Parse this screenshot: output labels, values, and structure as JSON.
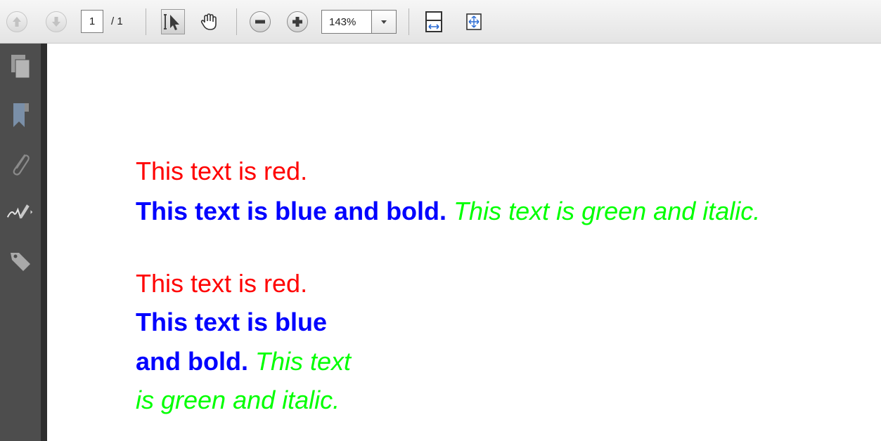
{
  "toolbar": {
    "page_number": "1",
    "page_total": "/ 1",
    "zoom": "143%"
  },
  "document": {
    "block1": {
      "red": "This text is red.",
      "blue": "This text is blue and bold.",
      "green": "This text is green and italic."
    },
    "block2": {
      "red": "This text is red.",
      "blue_line1": "This text is blue",
      "blue_line2": "and bold.",
      "green_line1": "This text",
      "green_line2": "is green and italic."
    }
  },
  "colors": {
    "red": "#ff0000",
    "blue": "#0000ff",
    "green": "#00ff00",
    "rail": "#4d4d4d"
  },
  "icons": [
    "arrow-up-icon",
    "arrow-down-icon",
    "select-cursor-icon",
    "hand-icon",
    "minus-icon",
    "plus-icon",
    "dropdown-arrow-icon",
    "fit-width-icon",
    "fit-page-icon",
    "pages-icon",
    "bookmark-icon",
    "paperclip-icon",
    "signature-icon",
    "tag-icon"
  ]
}
